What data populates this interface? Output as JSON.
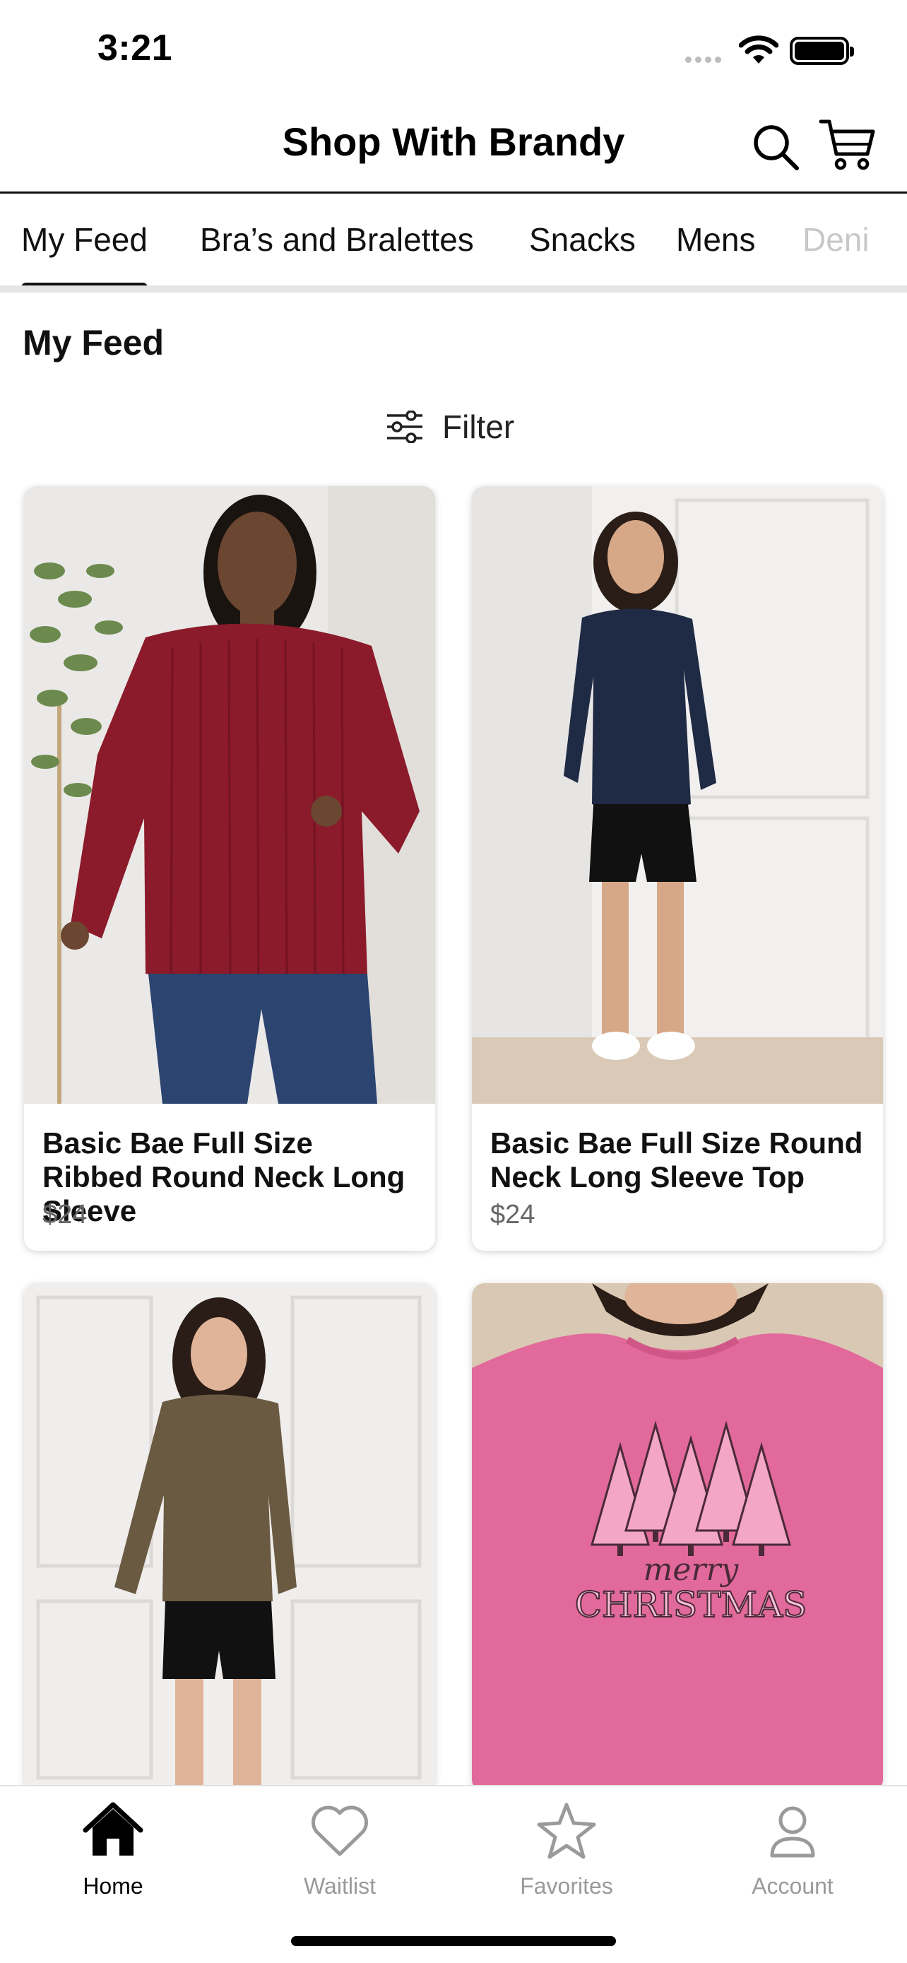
{
  "status_bar": {
    "time": "3:21"
  },
  "header": {
    "title": "Shop With Brandy"
  },
  "tabs": [
    {
      "label": "My Feed",
      "active": true
    },
    {
      "label": "Bra’s and Bralettes"
    },
    {
      "label": "Snacks"
    },
    {
      "label": "Mens"
    },
    {
      "label": "Deni"
    }
  ],
  "section": {
    "title": "My Feed"
  },
  "filter": {
    "label": "Filter"
  },
  "products": [
    {
      "name": "Basic Bae Full Size Ribbed Round Neck Long Sleeve",
      "price": "$24",
      "colors": {
        "top": "#8b1a2a",
        "pants": "#2b4470",
        "bg": "#ebe9e7"
      }
    },
    {
      "name": "Basic Bae Full Size Round Neck Long Sleeve Top",
      "price": "$24",
      "colors": {
        "top": "#1f2a44",
        "pants": "#111111",
        "bg": "#f1f0ee"
      }
    },
    {
      "name": "",
      "price": "",
      "colors": {
        "top": "#6b5a42",
        "pants": "#111111",
        "bg": "#efeeec"
      }
    },
    {
      "name": "",
      "price": "",
      "graphic_text": "merry CHRISTMAS",
      "colors": {
        "top": "#e2699b",
        "bg": "#d9c9b4"
      }
    }
  ],
  "bottom_nav": [
    {
      "label": "Home",
      "icon": "home-icon",
      "active": true
    },
    {
      "label": "Waitlist",
      "icon": "heart-icon"
    },
    {
      "label": "Favorites",
      "icon": "star-icon"
    },
    {
      "label": "Account",
      "icon": "person-icon"
    }
  ]
}
